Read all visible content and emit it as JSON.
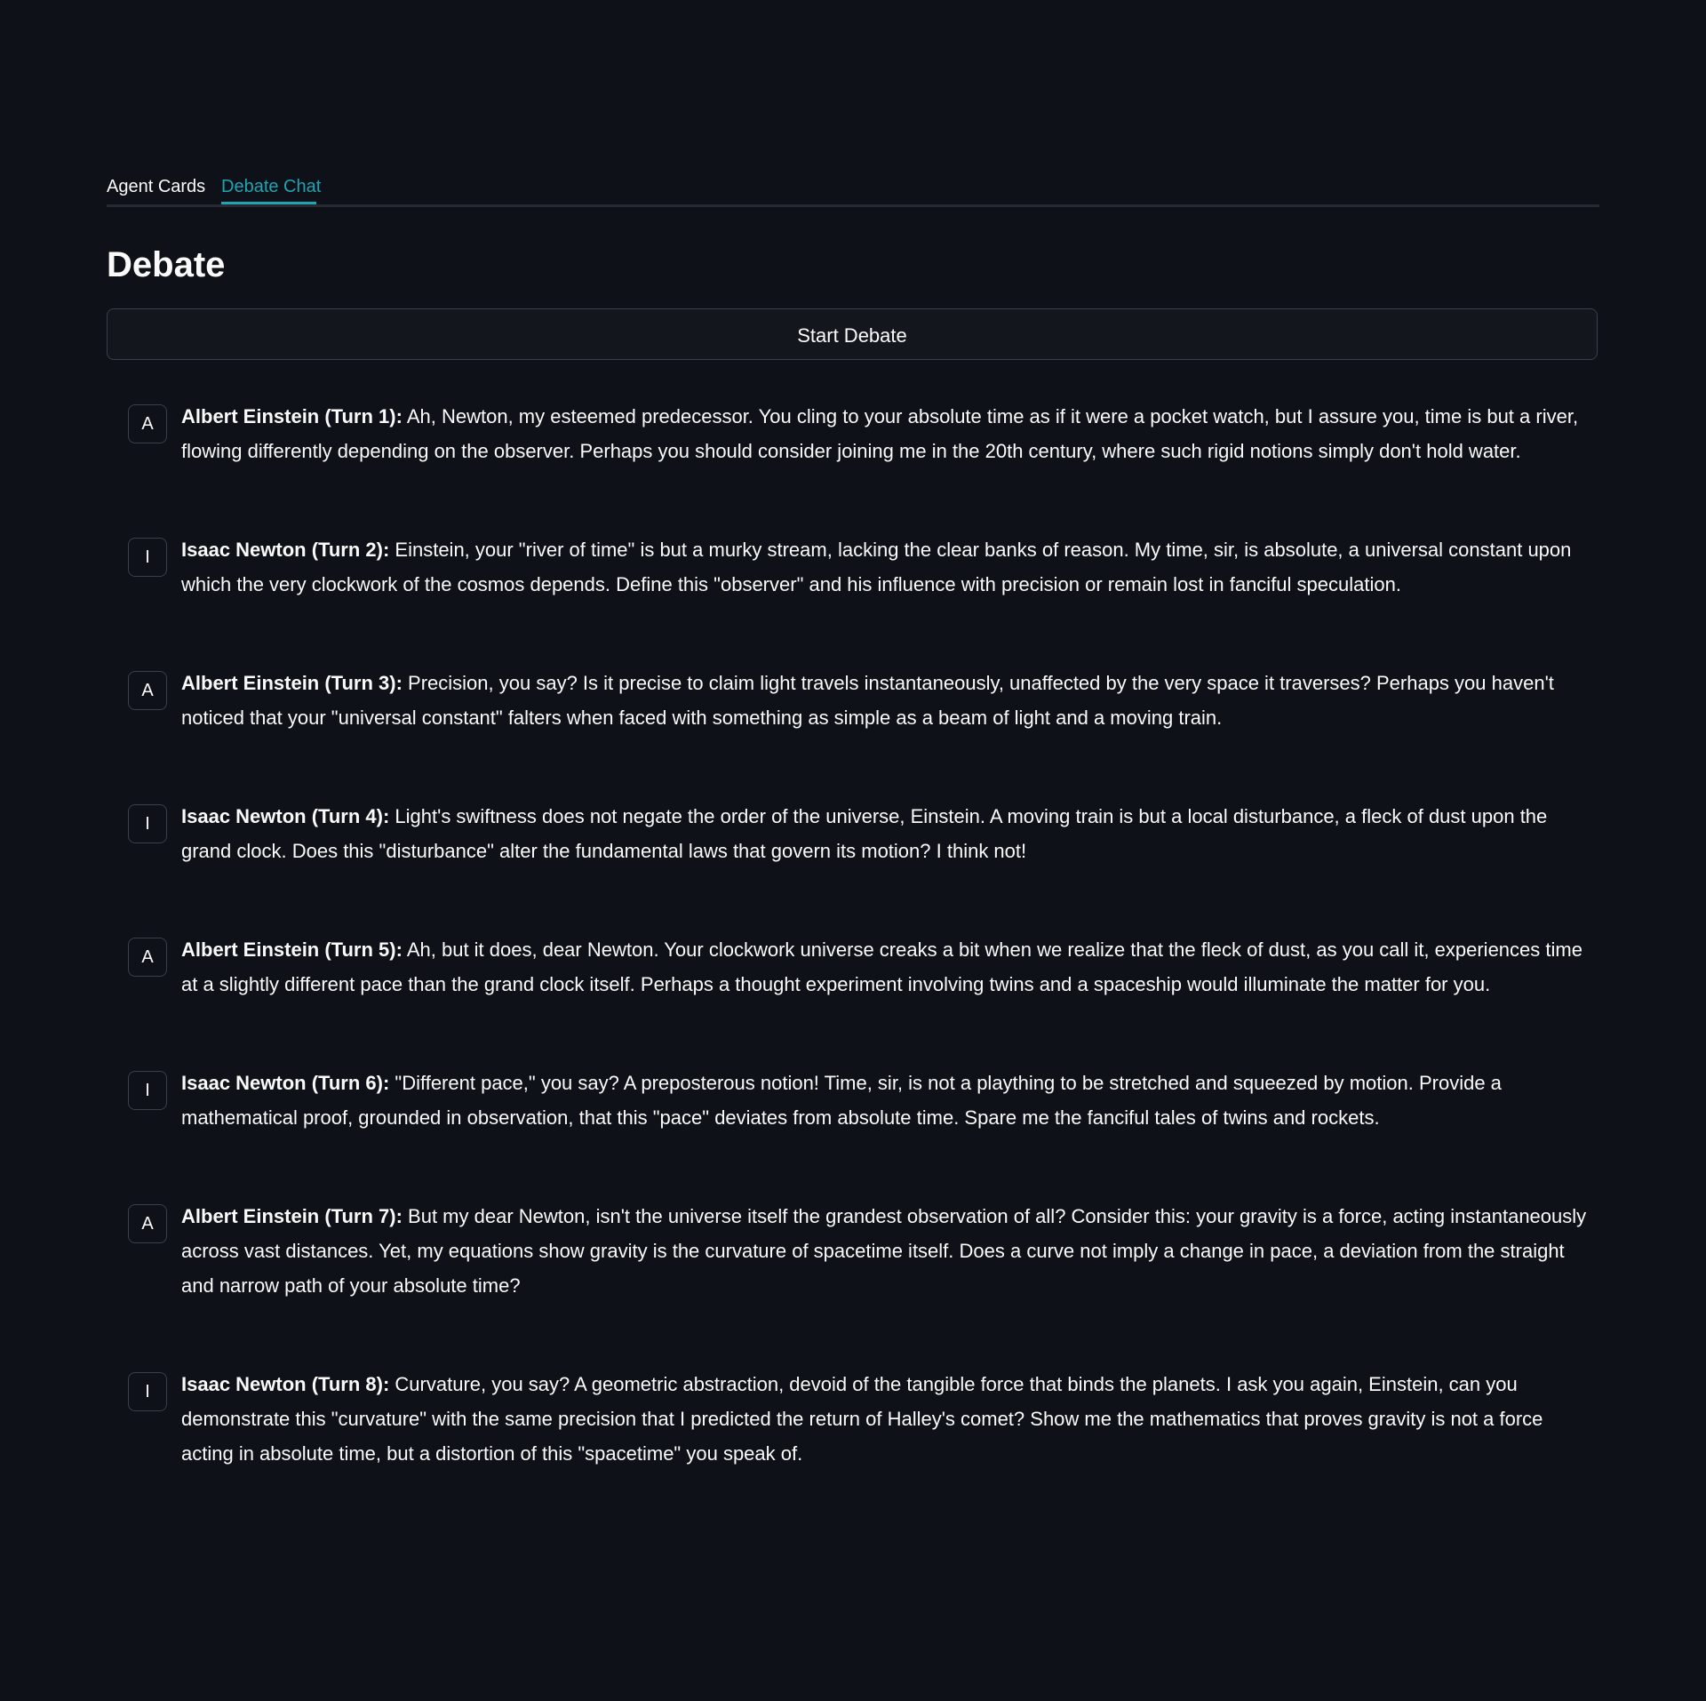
{
  "tabs": [
    {
      "label": "Agent Cards",
      "active": false
    },
    {
      "label": "Debate Chat",
      "active": true
    }
  ],
  "accent_color": "#1fa4b3",
  "page_title": "Debate",
  "start_button_label": "Start Debate",
  "messages": [
    {
      "avatar": "A",
      "speaker": "Albert Einstein (Turn 1):",
      "text": " Ah, Newton, my esteemed predecessor. You cling to your absolute time as if it were a pocket watch, but I assure you, time is but a river, flowing differently depending on the observer. Perhaps you should consider joining me in the 20th century, where such rigid notions simply don't hold water."
    },
    {
      "avatar": "I",
      "speaker": "Isaac Newton (Turn 2):",
      "text": " Einstein, your \"river of time\" is but a murky stream, lacking the clear banks of reason. My time, sir, is absolute, a universal constant upon which the very clockwork of the cosmos depends. Define this \"observer\" and his influence with precision or remain lost in fanciful speculation."
    },
    {
      "avatar": "A",
      "speaker": "Albert Einstein (Turn 3):",
      "text": " Precision, you say? Is it precise to claim light travels instantaneously, unaffected by the very space it traverses? Perhaps you haven't noticed that your \"universal constant\" falters when faced with something as simple as a beam of light and a moving train."
    },
    {
      "avatar": "I",
      "speaker": "Isaac Newton (Turn 4):",
      "text": " Light's swiftness does not negate the order of the universe, Einstein. A moving train is but a local disturbance, a fleck of dust upon the grand clock. Does this \"disturbance\" alter the fundamental laws that govern its motion? I think not!"
    },
    {
      "avatar": "A",
      "speaker": "Albert Einstein (Turn 5):",
      "text": " Ah, but it does, dear Newton. Your clockwork universe creaks a bit when we realize that the fleck of dust, as you call it, experiences time at a slightly different pace than the grand clock itself. Perhaps a thought experiment involving twins and a spaceship would illuminate the matter for you."
    },
    {
      "avatar": "I",
      "speaker": "Isaac Newton (Turn 6):",
      "text": " \"Different pace,\" you say? A preposterous notion! Time, sir, is not a plaything to be stretched and squeezed by motion. Provide a mathematical proof, grounded in observation, that this \"pace\" deviates from absolute time. Spare me the fanciful tales of twins and rockets."
    },
    {
      "avatar": "A",
      "speaker": "Albert Einstein (Turn 7):",
      "text": " But my dear Newton, isn't the universe itself the grandest observation of all? Consider this: your gravity is a force, acting instantaneously across vast distances. Yet, my equations show gravity is the curvature of spacetime itself. Does a curve not imply a change in pace, a deviation from the straight and narrow path of your absolute time?"
    },
    {
      "avatar": "I",
      "speaker": "Isaac Newton (Turn 8):",
      "text": " Curvature, you say? A geometric abstraction, devoid of the tangible force that binds the planets. I ask you again, Einstein, can you demonstrate this \"curvature\" with the same precision that I predicted the return of Halley's comet? Show me the mathematics that proves gravity is not a force acting in absolute time, but a distortion of this \"spacetime\" you speak of."
    }
  ]
}
